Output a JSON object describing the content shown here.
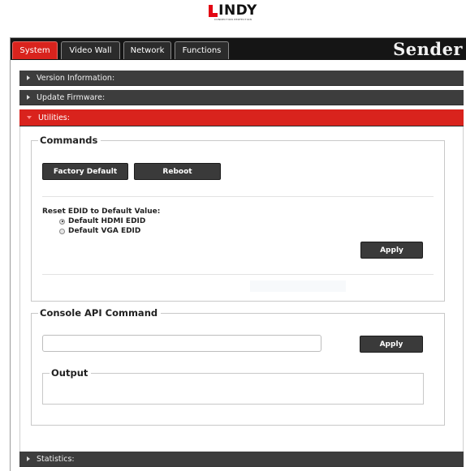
{
  "logo": {
    "brand_rest": "INDY",
    "tagline": "CONNECTION PERFECTION"
  },
  "tabs": [
    {
      "label": "System",
      "active": true
    },
    {
      "label": "Video Wall",
      "active": false
    },
    {
      "label": "Network",
      "active": false
    },
    {
      "label": "Functions",
      "active": false
    }
  ],
  "device_label": "Sender",
  "sections": {
    "version": "Version Information:",
    "firmware": "Update Firmware:",
    "utilities": "Utilities:",
    "statistics": "Statistics:"
  },
  "commands": {
    "legend": "Commands",
    "factory_default_label": "Factory Default",
    "reboot_label": "Reboot",
    "reset_edid_label": "Reset EDID to Default Value:",
    "edid_options": [
      {
        "label": "Default HDMI EDID",
        "checked": true
      },
      {
        "label": "Default VGA EDID",
        "checked": false
      }
    ],
    "apply_label": "Apply"
  },
  "console": {
    "legend": "Console API Command",
    "input_value": "",
    "apply_label": "Apply",
    "output_legend": "Output",
    "output_value": ""
  },
  "colors": {
    "accent_red": "#d9231d",
    "tabbar_bg": "#151515",
    "section_bg": "#3d3d3d",
    "button_bg": "#3a3a3a"
  }
}
